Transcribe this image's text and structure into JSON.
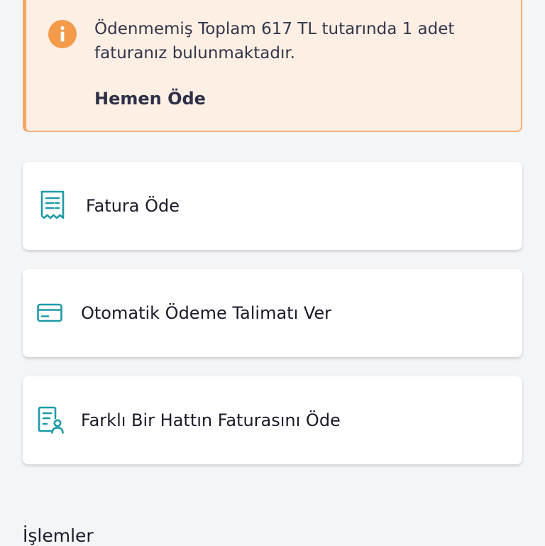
{
  "alert": {
    "icon": "info-icon",
    "message": "Ödenmemiş Toplam 617 TL tutarında 1 adet faturanız bulunmaktadır.",
    "action_label": "Hemen Öde",
    "colors": {
      "background": "#fdefe4",
      "border": "#f6a766",
      "icon": "#f39a4b"
    }
  },
  "cards": [
    {
      "icon": "receipt-icon",
      "label": "Fatura Öde"
    },
    {
      "icon": "credit-card-icon",
      "label": "Otomatik Ödeme Talimatı Ver"
    },
    {
      "icon": "document-user-icon",
      "label": "Farklı Bir Hattın Faturasını Öde"
    }
  ],
  "accent_color": "#1f9aa6",
  "section": {
    "title": "İşlemler"
  }
}
